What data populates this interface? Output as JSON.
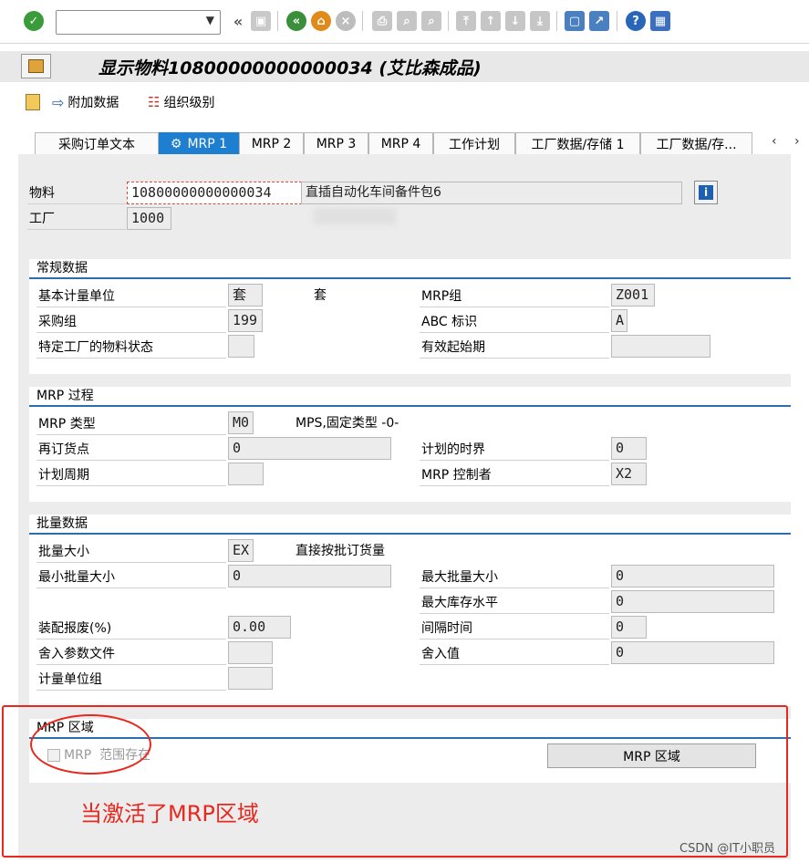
{
  "toolbar": {
    "command_value": "",
    "icons": [
      "enter-check-icon",
      "back-double-arrow-icon",
      "save-icon",
      "back-icon",
      "exit-icon",
      "cancel-icon",
      "print-icon",
      "find-icon",
      "find-next-icon",
      "first-page-icon",
      "prev-page-icon",
      "next-page-icon",
      "last-page-icon",
      "new-session-icon",
      "shortcut-icon",
      "help-icon",
      "customize-layout-icon"
    ]
  },
  "title": "显示物料10800000000000034 (艾比森成品)",
  "app_toolbar": {
    "additional_data": "附加数据",
    "org_levels": "组织级别"
  },
  "tabs": [
    {
      "label": "采购订单文本",
      "active": false
    },
    {
      "label": "MRP 1",
      "active": true
    },
    {
      "label": "MRP 2",
      "active": false
    },
    {
      "label": "MRP 3",
      "active": false
    },
    {
      "label": "MRP 4",
      "active": false
    },
    {
      "label": "工作计划",
      "active": false
    },
    {
      "label": "工厂数据/存储 1",
      "active": false
    },
    {
      "label": "工厂数据/存...",
      "active": false
    }
  ],
  "header": {
    "material_label": "物料",
    "material_value": "10800000000000034",
    "material_desc": "直插自动化车间备件包6",
    "plant_label": "工厂",
    "plant_value": "1000"
  },
  "general": {
    "title": "常规数据",
    "base_uom_label": "基本计量单位",
    "base_uom_value": "套",
    "base_uom_text": "套",
    "mrp_group_label": "MRP组",
    "mrp_group_value": "Z001",
    "purch_group_label": "采购组",
    "purch_group_value": "199",
    "abc_label": "ABC 标识",
    "abc_value": "A",
    "plant_status_label": "特定工厂的物料状态",
    "plant_status_value": "",
    "valid_from_label": "有效起始期",
    "valid_from_value": ""
  },
  "mrp_procedure": {
    "title": "MRP 过程",
    "mrp_type_label": "MRP 类型",
    "mrp_type_value": "M0",
    "mrp_type_text": "MPS,固定类型 -0-",
    "reorder_label": "再订货点",
    "reorder_value": "0",
    "time_fence_label": "计划的时界",
    "time_fence_value": "0",
    "planning_cycle_label": "计划周期",
    "planning_cycle_value": "",
    "controller_label": "MRP 控制者",
    "controller_value": "X2"
  },
  "lot_size": {
    "title": "批量数据",
    "lot_size_label": "批量大小",
    "lot_size_value": "EX",
    "lot_size_text": "直接按批订货量",
    "min_lot_label": "最小批量大小",
    "min_lot_value": "0",
    "max_lot_label": "最大批量大小",
    "max_lot_value": "0",
    "max_stock_label": "最大库存水平",
    "max_stock_value": "0",
    "assembly_scrap_label": "装配报废(%)",
    "assembly_scrap_value": "0.00",
    "takt_label": "间隔时间",
    "takt_value": "0",
    "rounding_profile_label": "舍入参数文件",
    "rounding_profile_value": "",
    "rounding_value_label": "舍入值",
    "rounding_value_value": "0",
    "unit_group_label": "计量单位组",
    "unit_group_value": ""
  },
  "mrp_areas": {
    "title": "MRP 区域",
    "checkbox_label": "MRP  范围存在",
    "checked": false,
    "button_label": "MRP 区域"
  },
  "annotation": {
    "text": "当激活了MRP区域",
    "color": "#e8281e"
  },
  "watermark": "CSDN @IT小职员"
}
